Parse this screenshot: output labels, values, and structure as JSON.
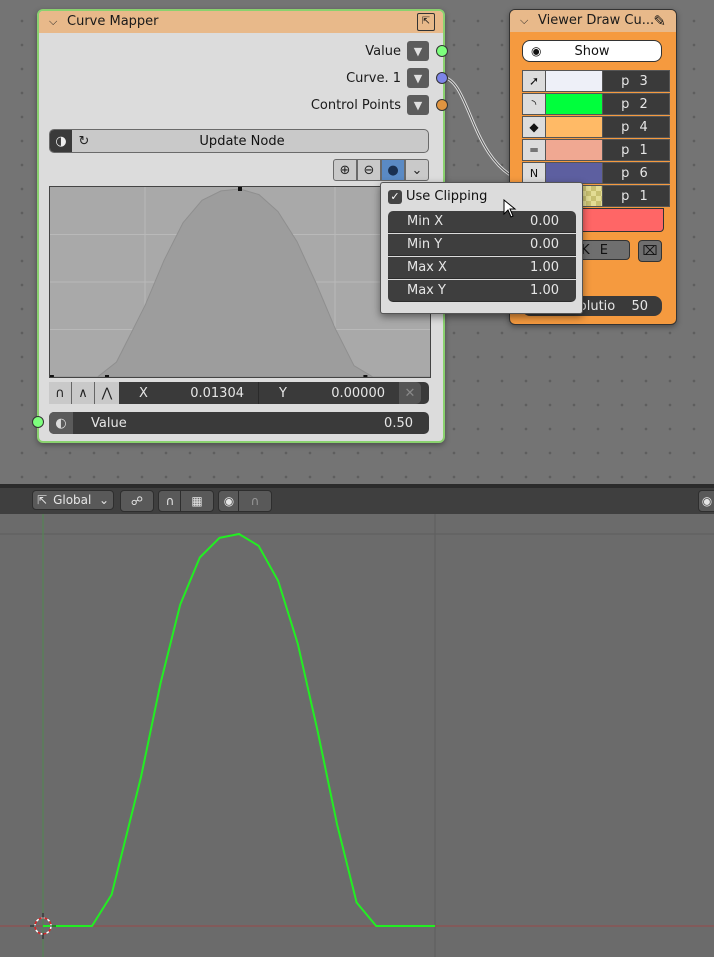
{
  "colors": {
    "node_select": "#8ad16f",
    "curve_green": "#22ee22",
    "socket_green": "#7dff7d",
    "socket_blue": "#7d85e8",
    "socket_orange": "#e09440",
    "viewer_bg": "#f59a3f",
    "red_row": "#ff6666"
  },
  "curve_node": {
    "title": "Curve Mapper",
    "outputs": [
      {
        "label": "Value"
      },
      {
        "label": "Curve. 1"
      },
      {
        "label": "Control Points"
      }
    ],
    "update_button": "Update Node",
    "point": {
      "x_label": "X",
      "x_value": "0.01304",
      "y_label": "Y",
      "y_value": "0.00000"
    },
    "value_input": {
      "label": "Value",
      "value": "0.50"
    }
  },
  "clip_popup": {
    "use_clipping_label": "Use Clipping",
    "use_clipping_checked": true,
    "fields": [
      {
        "label": "Min X",
        "value": "0.00"
      },
      {
        "label": "Min Y",
        "value": "0.00"
      },
      {
        "label": "Max X",
        "value": "1.00"
      },
      {
        "label": "Max Y",
        "value": "1.00"
      }
    ]
  },
  "viewer_node": {
    "title": "Viewer Draw Cu...",
    "show_button": "Show",
    "rows": [
      {
        "icon": "vertex-icon",
        "swatch": "#eef0f8",
        "label": "p 3"
      },
      {
        "icon": "curve-icon",
        "swatch": "#00ff3c",
        "label": "p 2"
      },
      {
        "icon": "diamond-icon",
        "swatch": "#ffba66",
        "label": "p 4"
      },
      {
        "icon": "lines-icon",
        "swatch": "#f0a892",
        "label": "p 1"
      },
      {
        "icon": "normals-icon",
        "swatch": "#5d5fa0",
        "label": "p 6"
      },
      {
        "icon": "checker-icon",
        "swatch": "#c8c070",
        "label": "p 1"
      }
    ],
    "bake_label": "A K E",
    "resolution_label": "solutio",
    "resolution_value": "50"
  },
  "viewport_header": {
    "orientation_label": "Global"
  },
  "curve_chart": {
    "description_points_x": [
      0.0,
      0.05,
      0.125,
      0.175,
      0.25,
      0.3,
      0.35,
      0.4,
      0.45,
      0.5,
      0.55,
      0.6,
      0.65,
      0.7,
      0.75,
      0.8,
      0.85,
      0.875,
      0.93,
      1.0
    ],
    "description_points_y": [
      0.0,
      0.0,
      0.0,
      0.08,
      0.38,
      0.62,
      0.82,
      0.94,
      0.99,
      1.0,
      0.97,
      0.88,
      0.72,
      0.5,
      0.26,
      0.06,
      0.0,
      0.0,
      0.0,
      0.0
    ]
  }
}
